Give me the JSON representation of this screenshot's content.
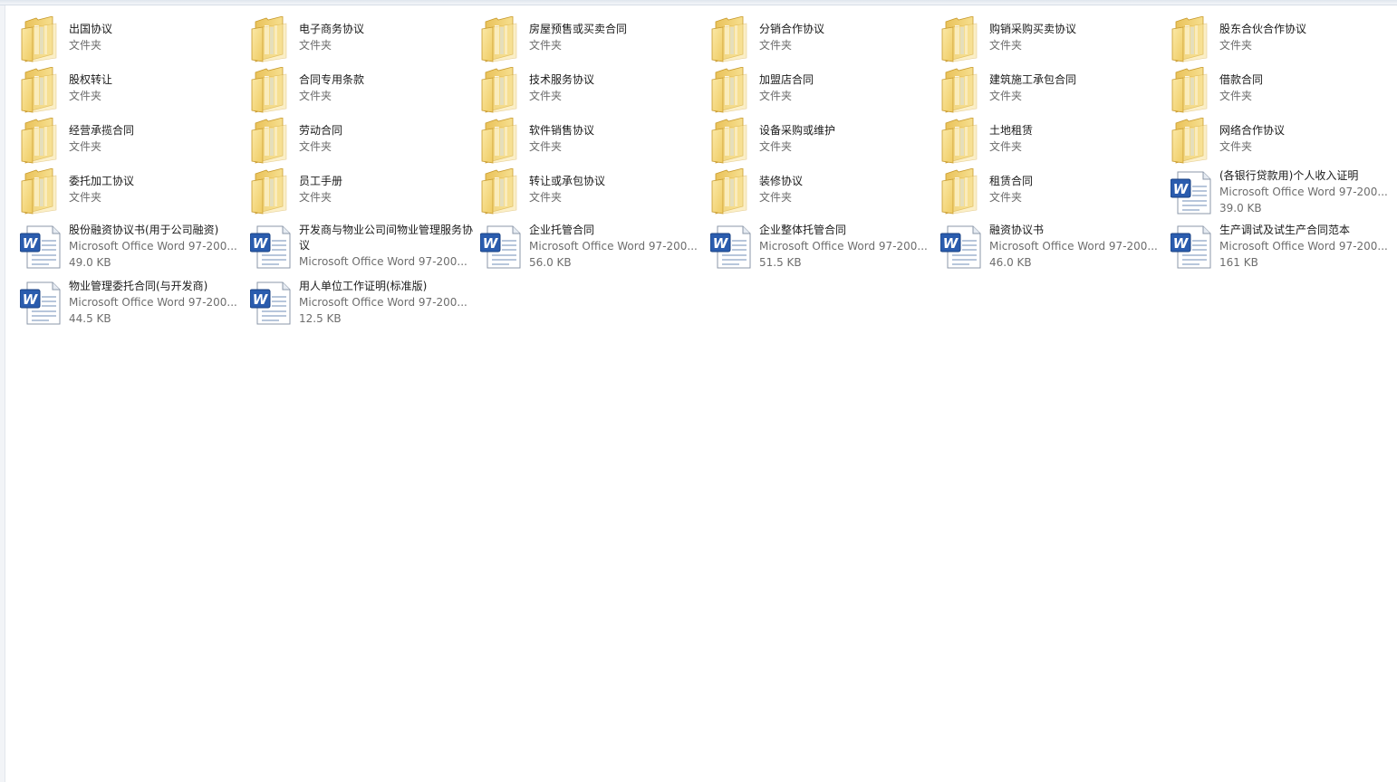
{
  "folder_type": "文件夹",
  "rows": [
    [
      {
        "name": "出国协议",
        "kind": "folder"
      },
      {
        "name": "电子商务协议",
        "kind": "folder"
      },
      {
        "name": "房屋预售或买卖合同",
        "kind": "folder"
      },
      {
        "name": "分销合作协议",
        "kind": "folder"
      },
      {
        "name": "购销采购买卖协议",
        "kind": "folder"
      },
      {
        "name": "股东合伙合作协议",
        "kind": "folder"
      }
    ],
    [
      {
        "name": "股权转让",
        "kind": "folder"
      },
      {
        "name": "合同专用条款",
        "kind": "folder"
      },
      {
        "name": "技术服务协议",
        "kind": "folder"
      },
      {
        "name": "加盟店合同",
        "kind": "folder"
      },
      {
        "name": "建筑施工承包合同",
        "kind": "folder"
      },
      {
        "name": "借款合同",
        "kind": "folder"
      }
    ],
    [
      {
        "name": "经营承揽合同",
        "kind": "folder"
      },
      {
        "name": "劳动合同",
        "kind": "folder"
      },
      {
        "name": "软件销售协议",
        "kind": "folder"
      },
      {
        "name": "设备采购或维护",
        "kind": "folder"
      },
      {
        "name": "土地租赁",
        "kind": "folder"
      },
      {
        "name": "网络合作协议",
        "kind": "folder"
      }
    ],
    [
      {
        "name": "委托加工协议",
        "kind": "folder"
      },
      {
        "name": "员工手册",
        "kind": "folder"
      },
      {
        "name": "转让或承包协议",
        "kind": "folder"
      },
      {
        "name": "装修协议",
        "kind": "folder"
      },
      {
        "name": "租赁合同",
        "kind": "folder"
      },
      {
        "name": "(各银行贷款用)个人收入证明",
        "kind": "doc",
        "type": "Microsoft Office Word 97-200...",
        "size": "39.0 KB"
      }
    ],
    [
      {
        "name": "股份融资协议书(用于公司融资)",
        "kind": "doc",
        "type": "Microsoft Office Word 97-200...",
        "size": "49.0 KB"
      },
      {
        "name": "开发商与物业公司间物业管理服务协议",
        "kind": "doc",
        "type": "Microsoft Office Word 97-200...",
        "size": ""
      },
      {
        "name": "企业托管合同",
        "kind": "doc",
        "type": "Microsoft Office Word 97-200...",
        "size": "56.0 KB"
      },
      {
        "name": "企业整体托管合同",
        "kind": "doc",
        "type": "Microsoft Office Word 97-200...",
        "size": "51.5 KB"
      },
      {
        "name": "融资协议书",
        "kind": "doc",
        "type": "Microsoft Office Word 97-200...",
        "size": "46.0 KB"
      },
      {
        "name": "生产调试及试生产合同范本",
        "kind": "doc",
        "type": "Microsoft Office Word 97-200...",
        "size": "161 KB"
      }
    ],
    [
      {
        "name": "物业管理委托合同(与开发商)",
        "kind": "doc",
        "type": "Microsoft Office Word 97-200...",
        "size": "44.5 KB"
      },
      {
        "name": "用人单位工作证明(标准版)",
        "kind": "doc",
        "type": "Microsoft Office Word 97-200...",
        "size": "12.5 KB"
      }
    ]
  ]
}
